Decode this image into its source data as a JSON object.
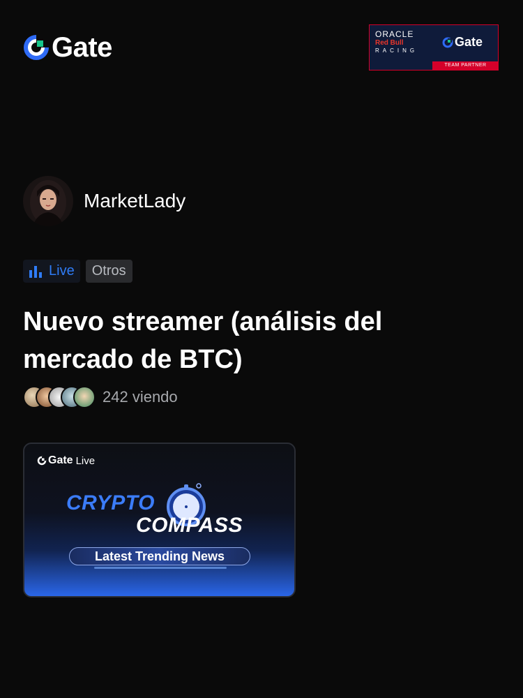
{
  "brand": {
    "name": "Gate",
    "accent": "#2f7cf6",
    "logo_icon": "gate-logo-icon"
  },
  "partner": {
    "oracle": "ORACLE",
    "redbull": "Red Bull",
    "racing": "RACING",
    "gate": "Gate",
    "band": "TEAM PARTNER"
  },
  "streamer": {
    "name": "MarketLady",
    "avatar_icon": "avatar-icon"
  },
  "tags": {
    "live": "Live",
    "category": "Otros"
  },
  "stream": {
    "title": "Nuevo streamer (análisis del mercado de BTC)",
    "viewers": "242 viendo"
  },
  "thumbnail": {
    "brand": "Gate",
    "brand_suffix": "Live",
    "line1": "CRYPTO",
    "line2": "COMPASS",
    "pill": "Latest Trending News"
  },
  "colors": {
    "background": "#0a0a0a",
    "live": "#2f7cf6",
    "category_bg": "#2a2b2e",
    "muted_text": "#a7a9ad"
  }
}
